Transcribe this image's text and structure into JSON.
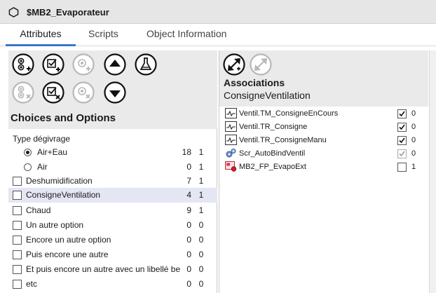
{
  "window": {
    "title": "$MB2_Evaporateur",
    "icon": "hexagon-icon"
  },
  "tabs": [
    {
      "label": "Attributes",
      "active": true
    },
    {
      "label": "Scripts",
      "active": false
    },
    {
      "label": "Object Information",
      "active": false
    }
  ],
  "left": {
    "section_title": "Choices and Options",
    "group_label": "Type dégivrage",
    "options": [
      {
        "label": "Air+Eau",
        "kind": "radio",
        "checked": true,
        "n1": "18",
        "n2": "1"
      },
      {
        "label": "Air",
        "kind": "radio",
        "checked": false,
        "n1": "0",
        "n2": "1"
      },
      {
        "label": "Deshumidification",
        "kind": "check",
        "checked": false,
        "n1": "7",
        "n2": "1"
      },
      {
        "label": "ConsigneVentilation",
        "kind": "check",
        "checked": false,
        "n1": "4",
        "n2": "1",
        "selected": true
      },
      {
        "label": "Chaud",
        "kind": "check",
        "checked": false,
        "n1": "9",
        "n2": "1"
      },
      {
        "label": "Un autre option",
        "kind": "check",
        "checked": false,
        "n1": "0",
        "n2": "0"
      },
      {
        "label": "Encore un autre option",
        "kind": "check",
        "checked": false,
        "n1": "0",
        "n2": "0"
      },
      {
        "label": "Puis encore une autre",
        "kind": "check",
        "checked": false,
        "n1": "0",
        "n2": "0"
      },
      {
        "label": "Et puis encore un autre avec un libellé bea",
        "kind": "check",
        "checked": false,
        "n1": "0",
        "n2": "0"
      },
      {
        "label": "etc",
        "kind": "check",
        "checked": false,
        "n1": "0",
        "n2": "0"
      }
    ]
  },
  "right": {
    "title": "Associations",
    "subtitle": "ConsigneVentilation",
    "items": [
      {
        "label": "Ventil.TM_ConsigneEnCours",
        "icon": "trend-icon",
        "checked": true,
        "disabled": false,
        "count": "0"
      },
      {
        "label": "Ventil.TR_Consigne",
        "icon": "trend-icon",
        "checked": true,
        "disabled": false,
        "count": "0"
      },
      {
        "label": "Ventil.TR_ConsigneManu",
        "icon": "trend-icon",
        "checked": true,
        "disabled": false,
        "count": "0"
      },
      {
        "label": "Scr_AutoBindVentil",
        "icon": "script-gears-icon",
        "checked": true,
        "disabled": true,
        "count": "0"
      },
      {
        "label": "MB2_FP_EvapoExt",
        "icon": "faceplate-icon",
        "checked": false,
        "disabled": false,
        "count": "1"
      }
    ]
  },
  "colors": {
    "tab_accent": "#3b78c4",
    "selected_row": "#e4e6f3",
    "toolbar_bg": "#eaeaea",
    "titlebar_bg": "#e6e6e6"
  }
}
